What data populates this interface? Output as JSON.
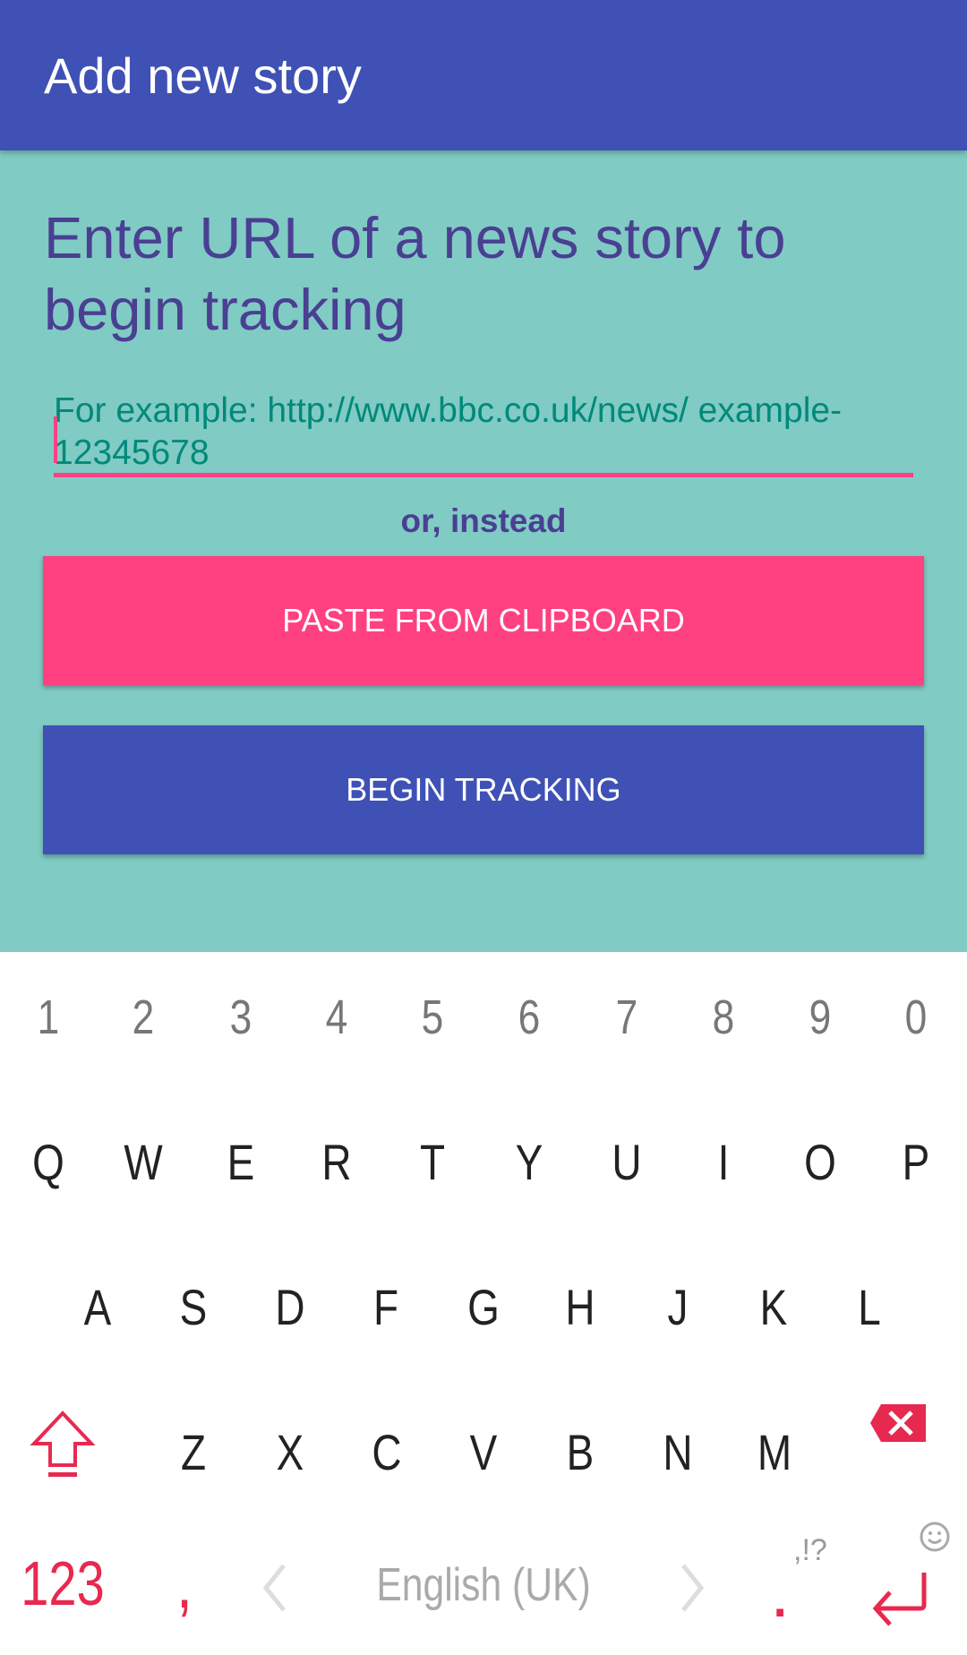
{
  "appbar": {
    "title": "Add new story"
  },
  "main": {
    "heading": "Enter URL of a news story to begin tracking",
    "url_input": {
      "value": "",
      "placeholder": "For example: http://www.bbc.co.uk/news/ example-12345678"
    },
    "or_label": "or, instead",
    "paste_button": "PASTE FROM CLIPBOARD",
    "begin_button": "BEGIN TRACKING"
  },
  "keyboard": {
    "numbers": [
      "1",
      "2",
      "3",
      "4",
      "5",
      "6",
      "7",
      "8",
      "9",
      "0"
    ],
    "row1": [
      "Q",
      "W",
      "E",
      "R",
      "T",
      "Y",
      "U",
      "I",
      "O",
      "P"
    ],
    "row2": [
      "A",
      "S",
      "D",
      "F",
      "G",
      "H",
      "J",
      "K",
      "L"
    ],
    "row3": [
      "Z",
      "X",
      "C",
      "V",
      "B",
      "N",
      "M"
    ],
    "symbols_key": "123",
    "comma_key": ",",
    "language": "English (UK)",
    "period_key": ".",
    "punct_hint": ",!?",
    "icons": [
      "shift-icon",
      "backspace-icon",
      "chevron-left-icon",
      "chevron-right-icon",
      "emoji-icon",
      "enter-icon"
    ],
    "accent_color": "#E8294F"
  },
  "colors": {
    "primary": "#3F51B5",
    "accent": "#FF4081",
    "background": "#80CBC4"
  }
}
